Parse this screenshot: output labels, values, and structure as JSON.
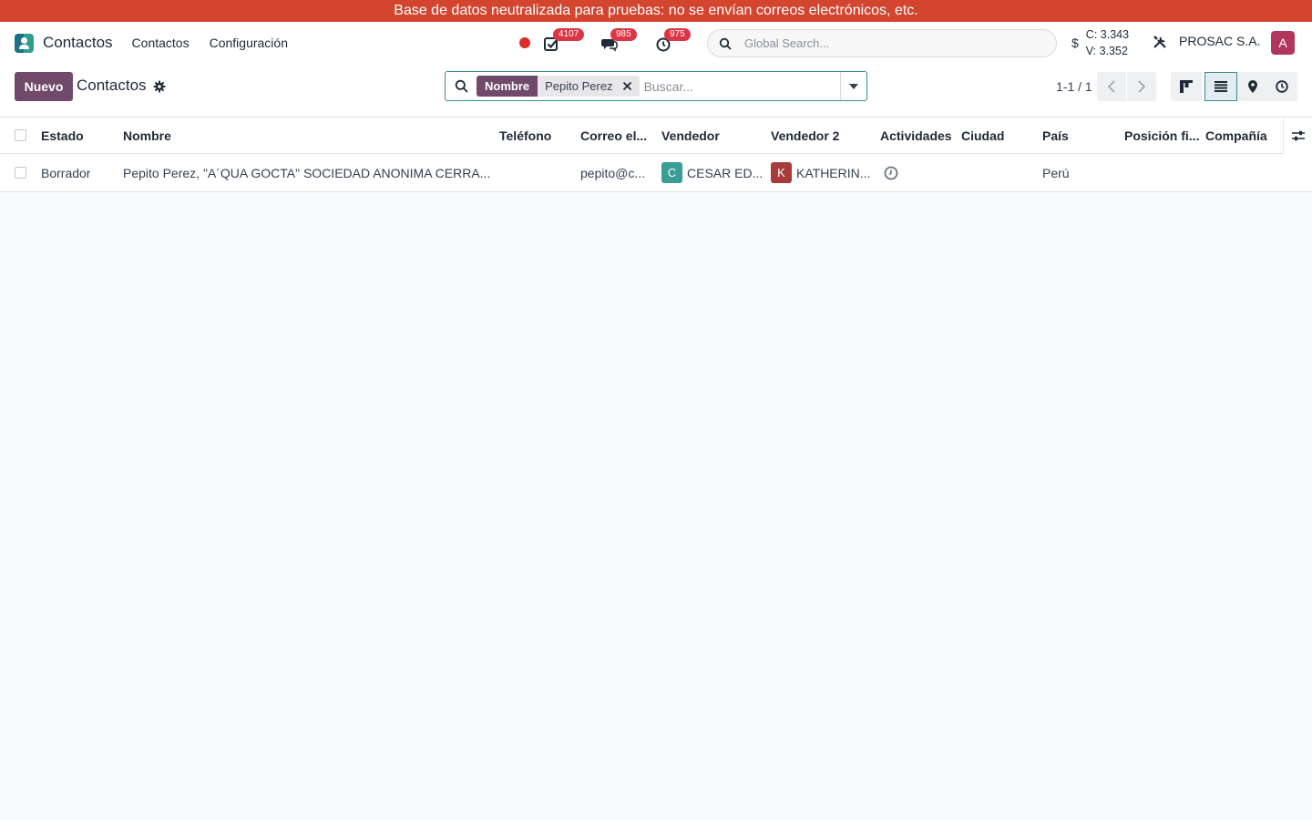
{
  "banner": {
    "text": "Base de datos neutralizada para pruebas: no se envían correos electrónicos, etc."
  },
  "navbar": {
    "app_name": "Contactos",
    "menu": [
      "Contactos",
      "Configuración"
    ],
    "badges": {
      "activities": "4107",
      "messages": "985",
      "timesheets": "975"
    },
    "global_search_placeholder": "Global Search...",
    "currency_symbol": "$",
    "rate_buy": "C: 3.343",
    "rate_sell": "V: 3.352",
    "company": "PROSAC S.A.",
    "user_initial": "A"
  },
  "control_panel": {
    "new_button": "Nuevo",
    "breadcrumb": "Contactos",
    "search": {
      "facet_label": "Nombre",
      "facet_value": "Pepito Perez",
      "placeholder": "Buscar..."
    },
    "pager": "1-1 / 1"
  },
  "list": {
    "columns": [
      "Estado",
      "Nombre",
      "Teléfono",
      "Correo el...",
      "Vendedor",
      "Vendedor 2",
      "Actividades",
      "Ciudad",
      "País",
      "Posición fi...",
      "Compañía"
    ],
    "rows": [
      {
        "estado": "Borrador",
        "nombre": "Pepito Perez, \"A´QUA GOCTA\" SOCIEDAD ANONIMA CERRA...",
        "telefono": "",
        "correo": "pepito@c...",
        "vendedor_initial": "C",
        "vendedor": "CESAR ED...",
        "vendedor2_initial": "K",
        "vendedor2": "KATHERIN...",
        "ciudad": "",
        "pais": "Perú",
        "posicion_fiscal": "",
        "compania": ""
      }
    ]
  },
  "colors": {
    "banner": "#d4452f",
    "primary": "#71496a",
    "avatar_c": "#3a9d96",
    "avatar_k": "#a93b3b",
    "avatar_user": "#b0365d"
  }
}
